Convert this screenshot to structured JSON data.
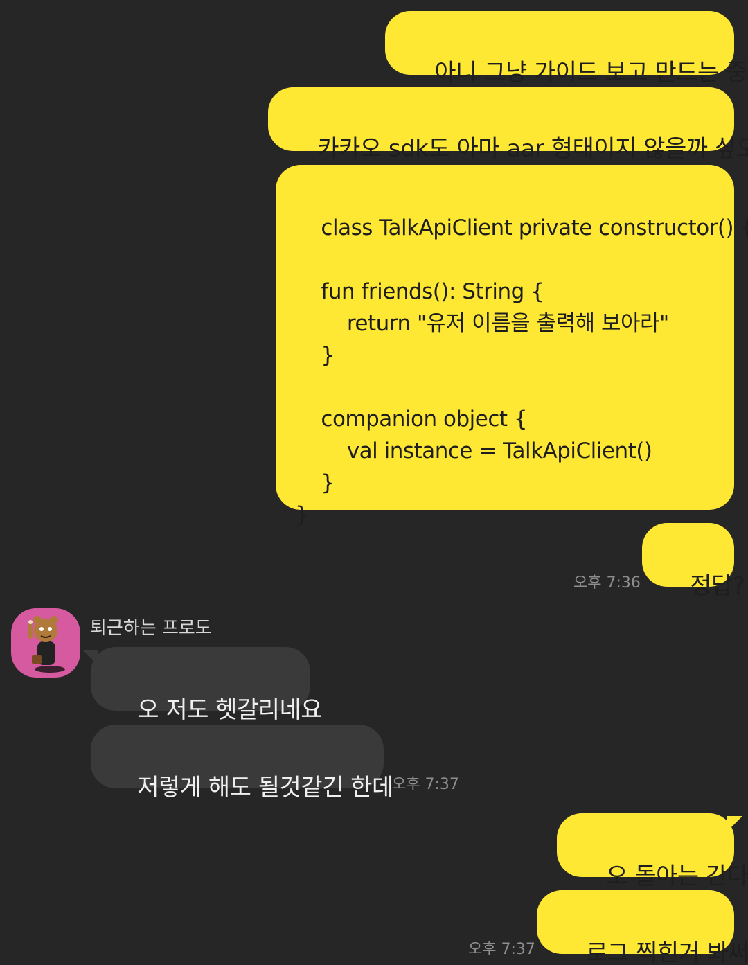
{
  "messages": {
    "m1": "아니 그냥 가이드 보고 만드는 중!",
    "m2": "카카오 sdk도 아마 aar 형태이지 않을까 싶오",
    "m3": "class TalkApiClient private constructor() {\n\n    fun friends(): String {\n        return \"유저 이름을 출력해 보아라\"\n    }\n\n    companion object {\n        val instance = TalkApiClient()\n    }\n}",
    "m4": "정답?",
    "m5": "오 저도 헷갈리네요",
    "m6": "저렇게 해도 될것같긴 한데",
    "m7": "오 돌아는 간다",
    "m8": "로그 찍힌거 봐써"
  },
  "times": {
    "t1": "오후 7:36",
    "t2": "오후 7:37",
    "t3": "오후 7:37"
  },
  "sender": {
    "name": "퇴근하는 프로도"
  },
  "colors": {
    "background": "#262626",
    "my_bubble": "#fee833",
    "other_bubble": "#3a3a3a",
    "avatar_bg": "#d55aa0"
  }
}
